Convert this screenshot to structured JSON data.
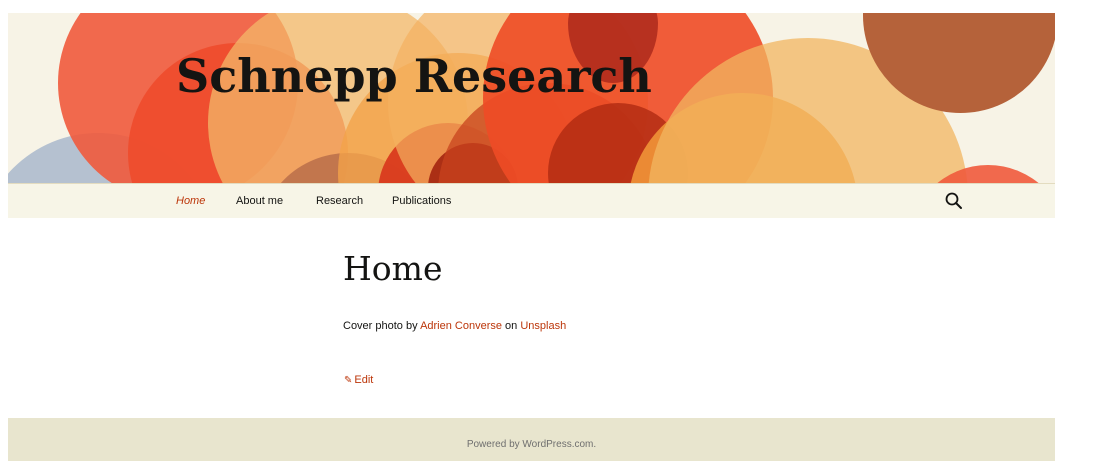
{
  "site": {
    "title": "Schnepp Research"
  },
  "nav": {
    "items": [
      {
        "label": "Home",
        "current": true
      },
      {
        "label": "About me",
        "current": false
      },
      {
        "label": "Research",
        "current": false
      },
      {
        "label": "Publications",
        "current": false
      }
    ],
    "search_icon": "search-icon"
  },
  "entry": {
    "title": "Home",
    "credit_prefix": "Cover photo by ",
    "photographer": "Adrien Converse",
    "credit_middle": " on ",
    "source": "Unsplash",
    "edit_label": "Edit",
    "edit_icon": "pencil-icon"
  },
  "footer": {
    "powered_prefix": "Powered by ",
    "powered_link": "WordPress.com",
    "powered_suffix": "."
  },
  "colors": {
    "accent": "#bc360a",
    "header_bg": "#f7f3e6",
    "nav_bg": "#f7f5e7",
    "footer_bg": "#e8e5ce",
    "text": "#141412"
  }
}
